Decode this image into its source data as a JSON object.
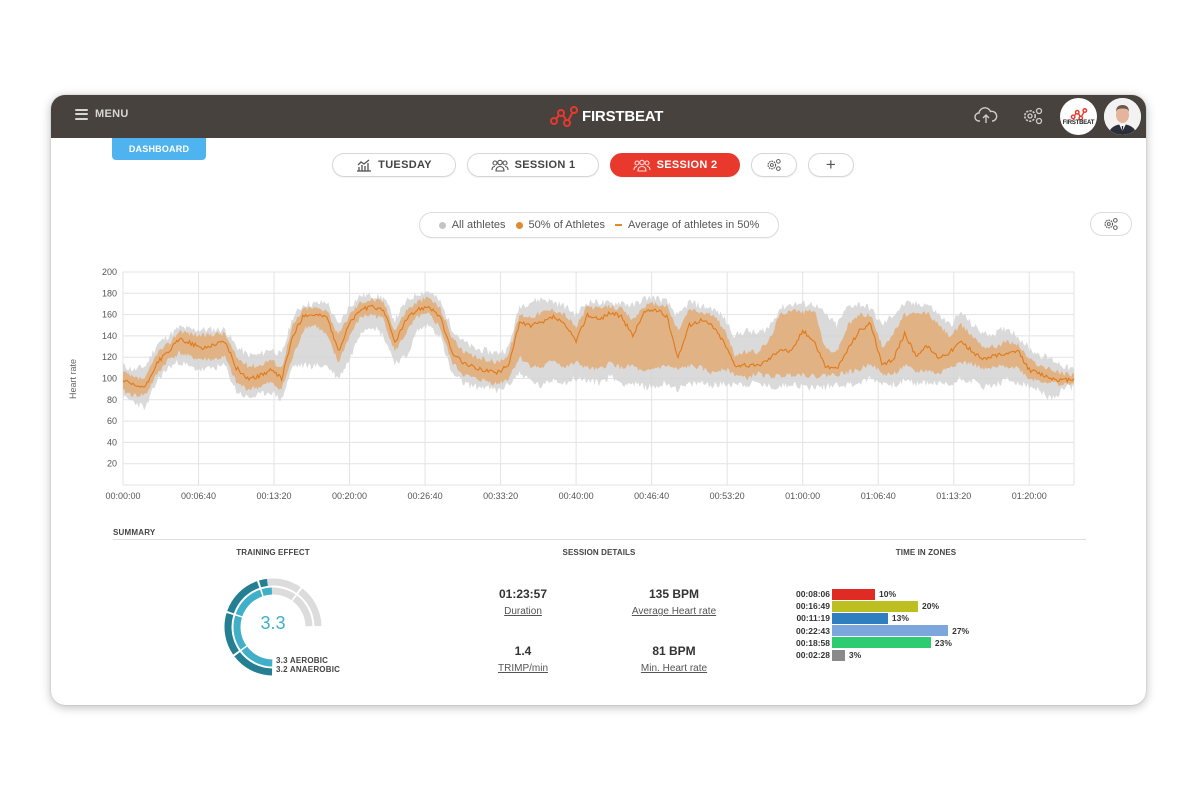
{
  "header": {
    "menu_label": "MENU",
    "brand": "FIRSTBEAT",
    "team_avatar_label": "FIRSTBEAT",
    "icons": [
      "menu-icon",
      "cloud-upload-icon",
      "settings-icon",
      "team-avatar",
      "user-avatar"
    ]
  },
  "nav": {
    "dashboard_label": "DASHBOARD",
    "tabs": [
      {
        "label": "TUESDAY",
        "icon": "chart-icon",
        "active": false
      },
      {
        "label": "SESSION 1",
        "icon": "group-icon",
        "active": false
      },
      {
        "label": "SESSION 2",
        "icon": "group-icon",
        "active": true
      }
    ],
    "settings_icon": "settings-icon",
    "add_label": "+"
  },
  "colors": {
    "topbar": "#47423e",
    "accent_red": "#e8392c",
    "dashboard_blue": "#4fb3ef",
    "all_athletes": "#c9c9c9",
    "fifty_percent": "#e08a2c",
    "average_line": "#e07a1c",
    "gauge_dark": "#237f91",
    "gauge_light": "#3fb0c8",
    "gauge_track": "#dcdcdc"
  },
  "legend": {
    "items": [
      {
        "label": "All athletes",
        "marker": "dot",
        "color": "#c4c4c4"
      },
      {
        "label": "50% of Athletes",
        "marker": "dot",
        "color": "#e08a2c"
      },
      {
        "label": "Average of athletes in 50%",
        "marker": "dash",
        "color": "#e08a2c"
      }
    ]
  },
  "chart_data": {
    "type": "area",
    "title": "",
    "xlabel": "",
    "ylabel": "Heart rate",
    "ylim": [
      0,
      200
    ],
    "yticks": [
      20,
      40,
      60,
      80,
      100,
      120,
      140,
      160,
      180,
      200
    ],
    "xlim_seconds": [
      0,
      5037
    ],
    "xticks": [
      "00:00:00",
      "00:06:40",
      "00:13:20",
      "00:20:00",
      "00:26:40",
      "00:33:20",
      "00:40:00",
      "00:46:40",
      "00:53:20",
      "01:00:00",
      "01:06:40",
      "01:13:20",
      "01:20:00"
    ],
    "grid": true,
    "legend_position": "top-center",
    "x_seconds": [
      0,
      60,
      120,
      180,
      240,
      300,
      360,
      420,
      480,
      540,
      600,
      660,
      720,
      780,
      840,
      900,
      960,
      1020,
      1080,
      1140,
      1200,
      1260,
      1320,
      1380,
      1440,
      1500,
      1560,
      1620,
      1680,
      1740,
      1800,
      1860,
      1920,
      1980,
      2040,
      2100,
      2160,
      2220,
      2280,
      2340,
      2400,
      2460,
      2520,
      2580,
      2640,
      2700,
      2760,
      2820,
      2880,
      2940,
      3000,
      3060,
      3120,
      3180,
      3240,
      3300,
      3360,
      3420,
      3480,
      3540,
      3600,
      3660,
      3720,
      3780,
      3840,
      3900,
      3960,
      4020,
      4080,
      4140,
      4200,
      4260,
      4320,
      4380,
      4440,
      4500,
      4560,
      4620,
      4680,
      4740,
      4800,
      4860,
      4920,
      4980,
      5037
    ],
    "series": [
      {
        "name": "Average of athletes in 50%",
        "values": [
          98,
          93,
          92,
          115,
          125,
          137,
          133,
          128,
          132,
          135,
          110,
          100,
          102,
          108,
          100,
          140,
          160,
          160,
          158,
          125,
          152,
          165,
          167,
          165,
          134,
          155,
          165,
          168,
          158,
          125,
          115,
          110,
          108,
          105,
          112,
          152,
          150,
          152,
          158,
          150,
          135,
          160,
          155,
          162,
          158,
          140,
          162,
          165,
          158,
          120,
          150,
          155,
          150,
          135,
          113,
          112,
          112,
          118,
          128,
          125,
          145,
          135,
          112,
          108,
          128,
          145,
          152,
          112,
          118,
          142,
          122,
          130,
          120,
          125,
          135,
          125,
          118,
          122,
          122,
          126,
          108,
          104,
          100,
          98,
          100
        ]
      },
      {
        "name": "50% of Athletes",
        "lower": [
          88,
          84,
          85,
          104,
          118,
          124,
          120,
          118,
          118,
          120,
          96,
          90,
          92,
          96,
          90,
          120,
          148,
          150,
          140,
          115,
          140,
          158,
          160,
          156,
          125,
          143,
          158,
          160,
          148,
          116,
          104,
          100,
          98,
          95,
          100,
          120,
          112,
          110,
          118,
          110,
          115,
          110,
          108,
          115,
          110,
          112,
          105,
          110,
          112,
          108,
          112,
          110,
          105,
          110,
          104,
          100,
          105,
          102,
          102,
          104,
          104,
          102,
          103,
          104,
          106,
          108,
          115,
          104,
          104,
          112,
          106,
          108,
          104,
          112,
          115,
          114,
          108,
          110,
          112,
          110,
          100,
          98,
          96,
          94,
          96
        ],
        "upper": [
          106,
          100,
          100,
          124,
          132,
          145,
          142,
          140,
          142,
          142,
          120,
          112,
          112,
          118,
          110,
          150,
          166,
          166,
          165,
          140,
          160,
          172,
          174,
          172,
          145,
          164,
          172,
          176,
          166,
          140,
          125,
          120,
          118,
          115,
          122,
          160,
          158,
          162,
          165,
          160,
          148,
          168,
          165,
          168,
          165,
          155,
          168,
          170,
          168,
          145,
          165,
          162,
          160,
          148,
          122,
          125,
          125,
          135,
          160,
          165,
          162,
          165,
          128,
          125,
          150,
          160,
          160,
          130,
          142,
          160,
          160,
          162,
          150,
          140,
          150,
          140,
          130,
          130,
          135,
          132,
          118,
          112,
          108,
          105,
          104
        ]
      },
      {
        "name": "All athletes",
        "lower": [
          82,
          78,
          72,
          98,
          110,
          116,
          110,
          108,
          110,
          112,
          88,
          82,
          84,
          88,
          80,
          112,
          112,
          112,
          112,
          100,
          118,
          145,
          150,
          140,
          115,
          120,
          145,
          150,
          140,
          105,
          96,
          92,
          92,
          88,
          94,
          105,
          98,
          92,
          100,
          96,
          100,
          98,
          96,
          102,
          96,
          95,
          92,
          92,
          96,
          90,
          94,
          96,
          94,
          94,
          96,
          94,
          96,
          92,
          92,
          96,
          92,
          92,
          92,
          95,
          94,
          96,
          100,
          96,
          94,
          98,
          95,
          96,
          95,
          94,
          100,
          98,
          92,
          94,
          98,
          96,
          92,
          88,
          80,
          90,
          92
        ],
        "upper": [
          112,
          108,
          112,
          132,
          140,
          148,
          146,
          146,
          146,
          146,
          130,
          122,
          122,
          128,
          122,
          158,
          170,
          170,
          172,
          150,
          168,
          178,
          178,
          176,
          155,
          172,
          180,
          182,
          172,
          148,
          135,
          128,
          126,
          124,
          128,
          168,
          172,
          175,
          172,
          168,
          160,
          172,
          172,
          170,
          172,
          168,
          175,
          176,
          172,
          158,
          172,
          168,
          166,
          158,
          140,
          145,
          142,
          148,
          166,
          170,
          170,
          170,
          160,
          150,
          168,
          170,
          166,
          150,
          160,
          170,
          170,
          170,
          160,
          150,
          162,
          150,
          142,
          142,
          148,
          140,
          128,
          122,
          118,
          112,
          108
        ]
      }
    ]
  },
  "summary": {
    "title": "SUMMARY",
    "training_effect": {
      "title": "TRAINING EFFECT",
      "value": "3.3",
      "aerobic_label": "3.3 AEROBIC",
      "anaerobic_label": "3.2 ANAEROBIC",
      "aerobic": 3.3,
      "anaerobic": 3.2,
      "max": 5.0
    },
    "session_details": {
      "title": "SESSION DETAILS",
      "items": [
        {
          "value": "01:23:57",
          "label": "Duration"
        },
        {
          "value": "135 BPM",
          "label": "Average Heart rate"
        },
        {
          "value": "1.4",
          "label": "TRIMP/min"
        },
        {
          "value": "81 BPM",
          "label": "Min. Heart rate"
        }
      ]
    },
    "time_in_zones": {
      "title": "TIME IN ZONES",
      "zones": [
        {
          "time": "00:08:06",
          "percent": 10,
          "label": "10%",
          "color": "#e02b25"
        },
        {
          "time": "00:16:49",
          "percent": 20,
          "label": "20%",
          "color": "#bdbe1f"
        },
        {
          "time": "00:11:19",
          "percent": 13,
          "label": "13%",
          "color": "#2f7fc0"
        },
        {
          "time": "00:22:43",
          "percent": 27,
          "label": "27%",
          "color": "#7ba7dc"
        },
        {
          "time": "00:18:58",
          "percent": 23,
          "label": "23%",
          "color": "#2ecc71"
        },
        {
          "time": "00:02:28",
          "percent": 3,
          "label": "3%",
          "color": "#8a8a8a"
        }
      ]
    }
  }
}
